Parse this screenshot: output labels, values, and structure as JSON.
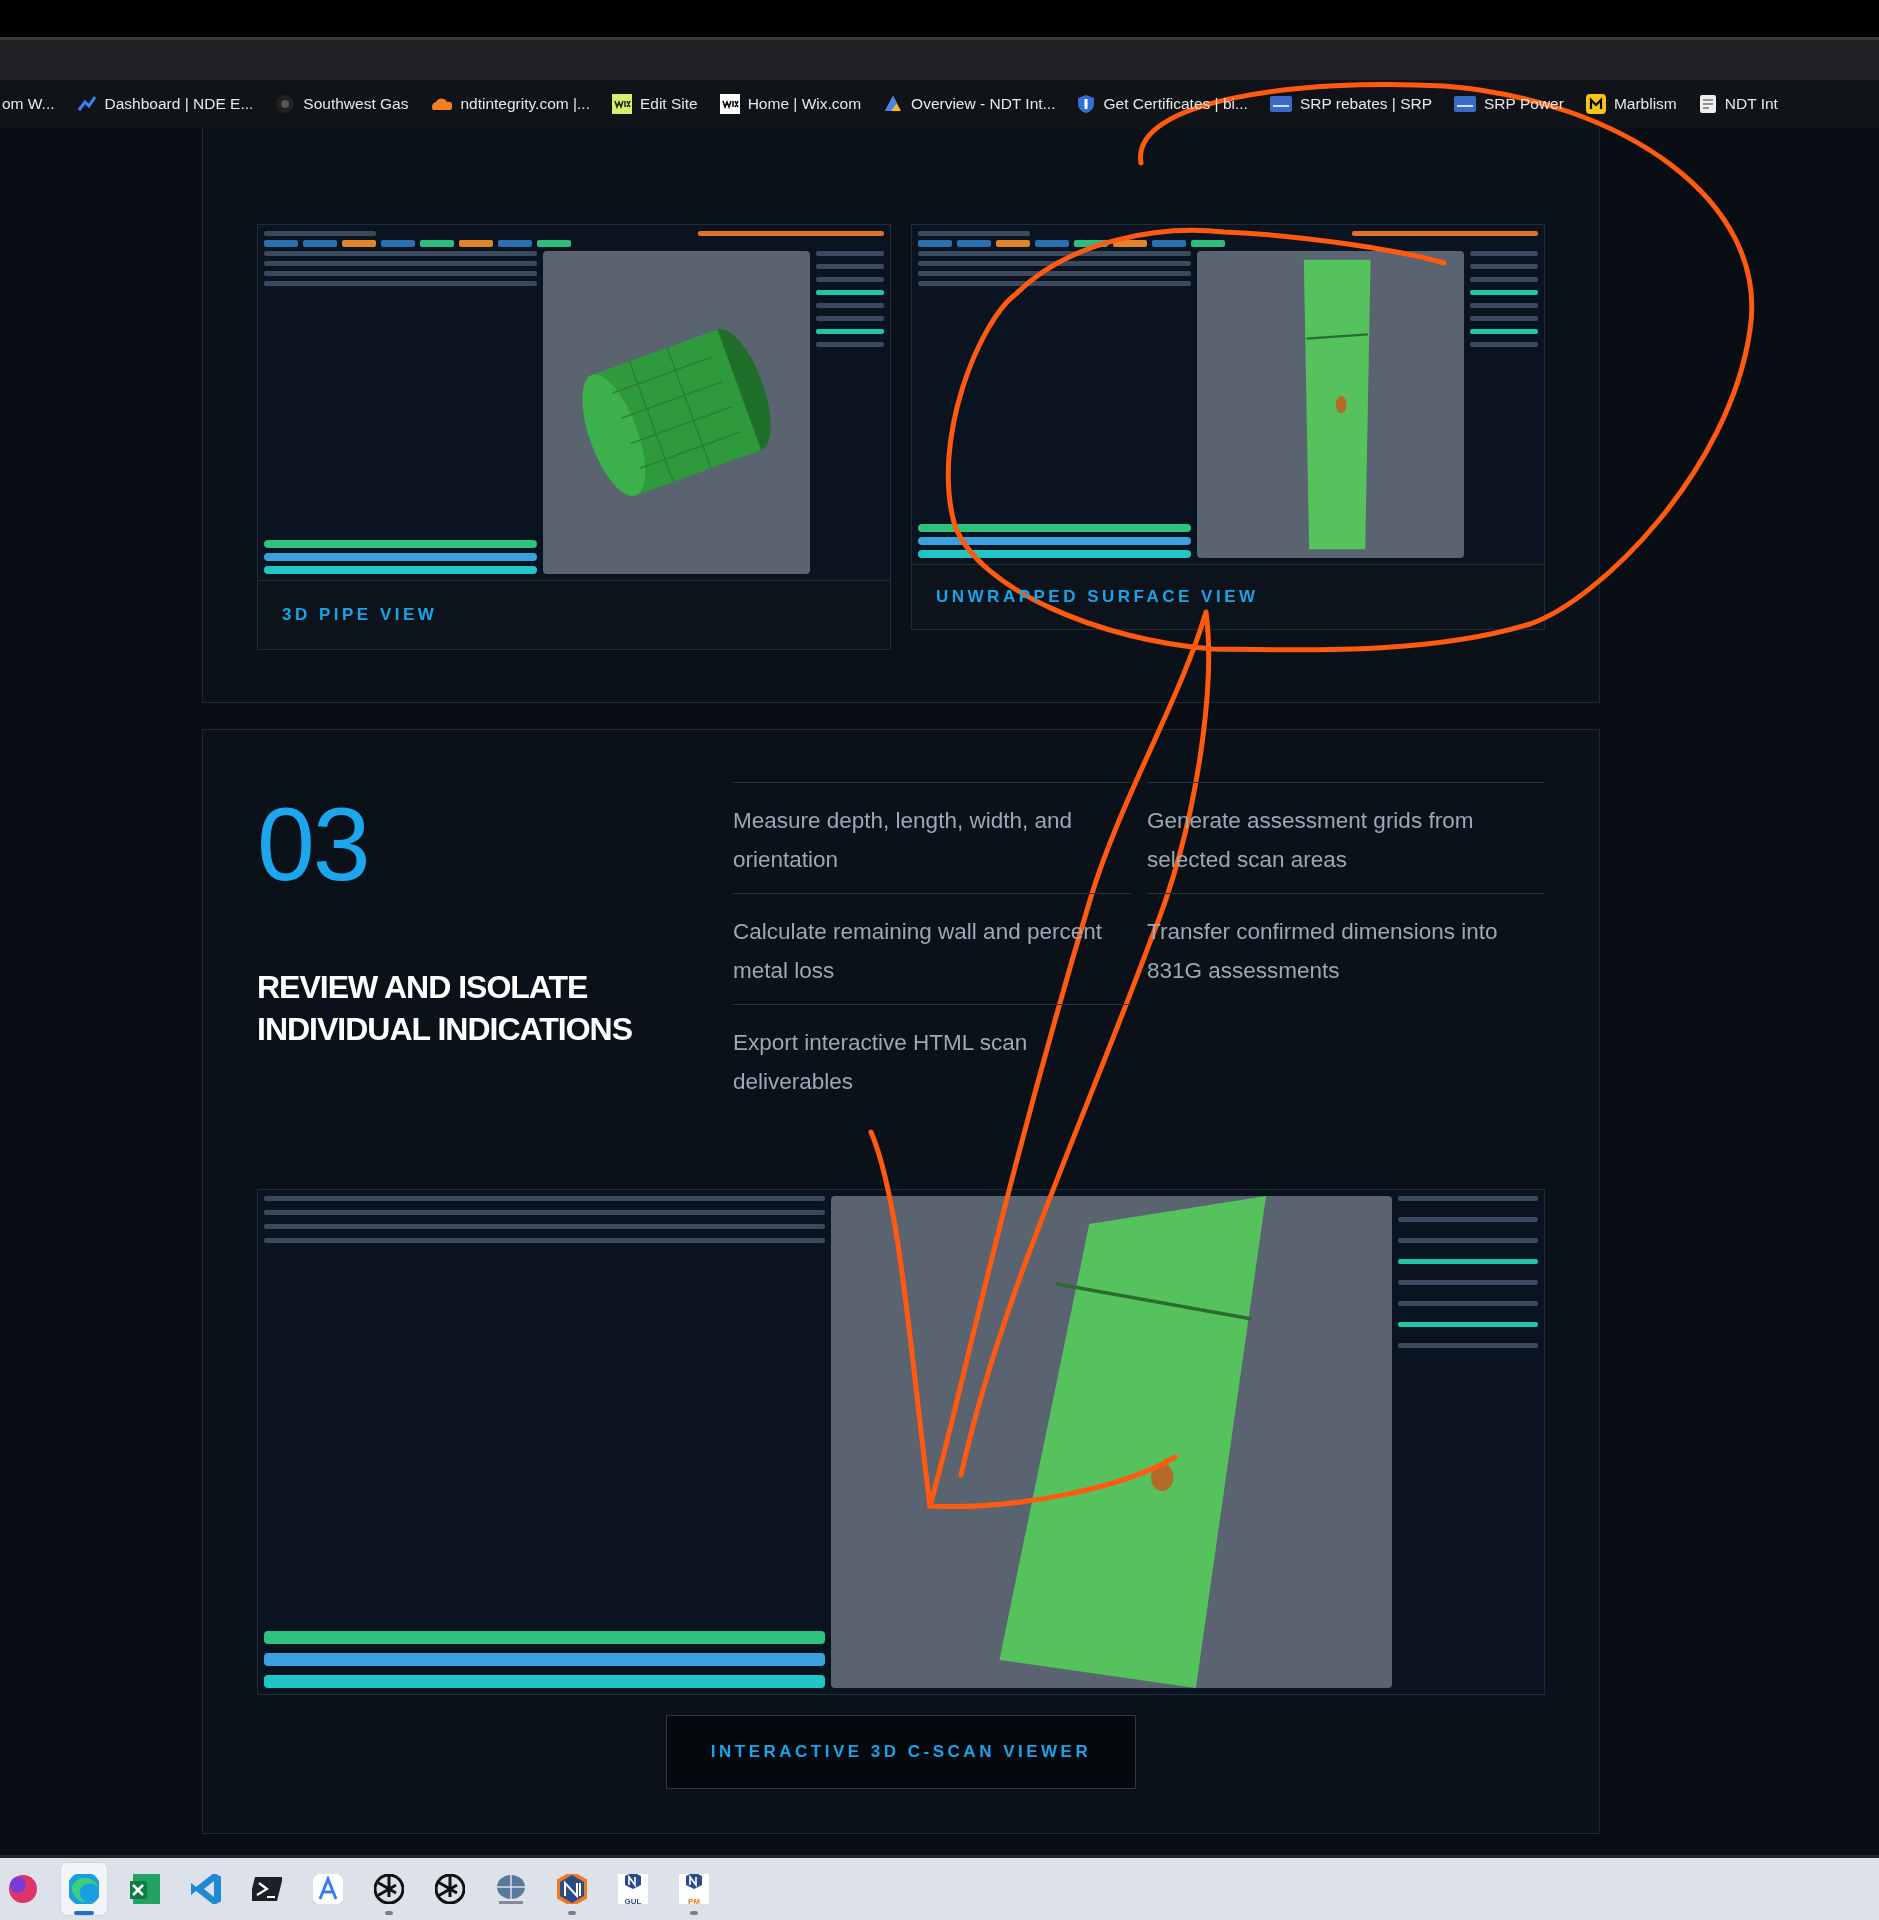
{
  "browser": {
    "bookmarks": [
      {
        "kind": "none",
        "label": "om W..."
      },
      {
        "kind": "chart",
        "label": "Dashboard | NDE E..."
      },
      {
        "kind": "dark-circle",
        "label": "Southwest Gas"
      },
      {
        "kind": "cloud",
        "label": "ndtintegrity.com |..."
      },
      {
        "kind": "wix-green",
        "label": "Edit Site"
      },
      {
        "kind": "wix",
        "label": "Home | Wix.com"
      },
      {
        "kind": "triangle",
        "label": "Overview - NDT Int..."
      },
      {
        "kind": "shield",
        "label": "Get Certificates | bi..."
      },
      {
        "kind": "srp",
        "label": "SRP rebates | SRP"
      },
      {
        "kind": "srp",
        "label": "SRP Power"
      },
      {
        "kind": "m-badge",
        "label": "Marblism"
      },
      {
        "kind": "doc",
        "label": "NDT Int"
      }
    ]
  },
  "gallery": {
    "cards": [
      {
        "kind": "pipe",
        "caption": "3D PIPE VIEW"
      },
      {
        "kind": "unwrapped",
        "caption": "UNWRAPPED SURFACE VIEW"
      }
    ]
  },
  "step": {
    "number": "03",
    "title": "REVIEW AND ISOLATE INDIVIDUAL INDICATIONS",
    "features": [
      "Measure depth, length, width, and orientation",
      "Generate assessment grids from selected scan areas",
      "Calculate remaining wall and percent metal loss",
      "Transfer confirmed dimensions into 831G assessments",
      "Export interactive HTML scan deliverables"
    ],
    "screenshot": {
      "kind": "flat"
    },
    "button": "INTERACTIVE 3D C-SCAN VIEWER"
  },
  "taskbar": {
    "apps": [
      {
        "kind": "swirl",
        "selected": false,
        "running": false
      },
      {
        "kind": "edge",
        "selected": true,
        "running": false
      },
      {
        "kind": "excel",
        "selected": false,
        "running": false
      },
      {
        "kind": "vscode",
        "selected": false,
        "running": false
      },
      {
        "kind": "terminal",
        "selected": false,
        "running": false
      },
      {
        "kind": "a-app",
        "selected": false,
        "running": false
      },
      {
        "kind": "knot",
        "selected": false,
        "running": true
      },
      {
        "kind": "knot",
        "selected": false,
        "running": false
      },
      {
        "kind": "globe",
        "selected": false,
        "running": false
      },
      {
        "kind": "ni",
        "selected": false,
        "running": true
      },
      {
        "kind": "ni-badge",
        "label": "GUL",
        "selected": false,
        "running": false
      },
      {
        "kind": "ni-badge",
        "label": "PM",
        "selected": false,
        "running": true
      }
    ]
  }
}
